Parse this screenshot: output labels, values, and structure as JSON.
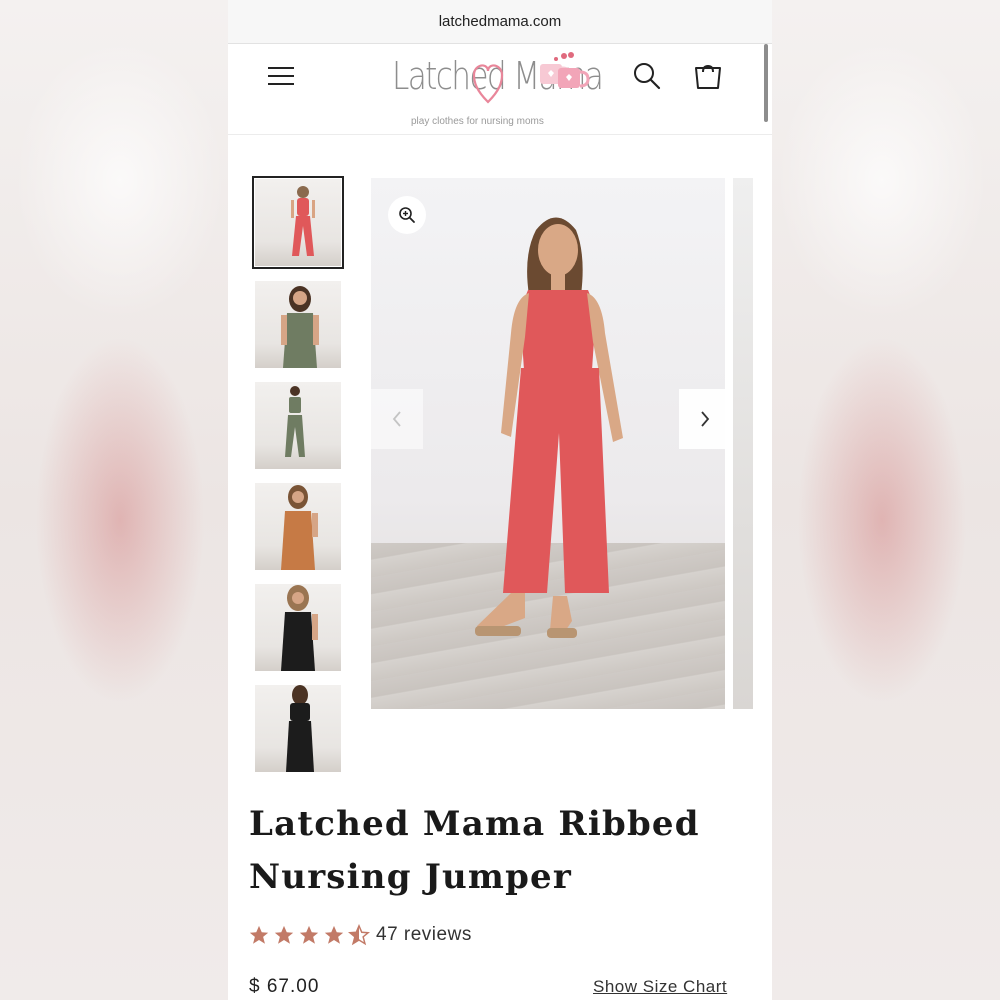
{
  "browser": {
    "url": "latchedmama.com"
  },
  "header": {
    "logo_text": "Latched Mama",
    "tagline": "play clothes for nursing moms"
  },
  "product": {
    "title": "Latched Mama Ribbed Nursing Jumper",
    "rating": 4.5,
    "review_count": "47 reviews",
    "price": "$ 67.00",
    "size_chart_label": "Show Size Chart",
    "image_count": 6,
    "selected_image_index": 0,
    "thumbnail_colors": [
      "coral red",
      "sage green",
      "sage green",
      "rust orange",
      "black",
      "black"
    ]
  },
  "colors": {
    "star": "#c27a67",
    "coral": "#e0585a",
    "sage": "#6f7c62",
    "rust": "#c67a45",
    "black": "#1c1c1c",
    "logo_heart": "#e9869a"
  }
}
